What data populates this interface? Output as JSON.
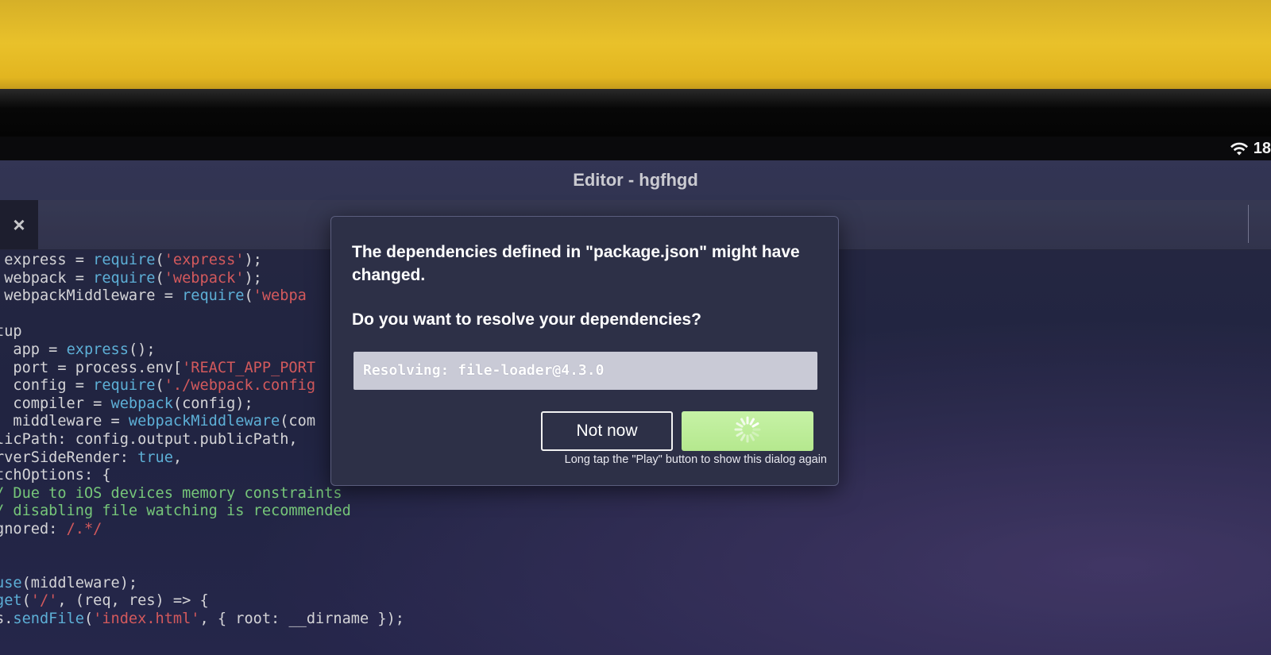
{
  "status": {
    "battery_text": "18",
    "wifi_icon": "wifi-icon"
  },
  "titlebar": {
    "title": "Editor - hgfhgd"
  },
  "tab": {
    "close_symbol": "×"
  },
  "code_lines": [
    [
      [
        "plain",
        " express = "
      ],
      [
        "fn",
        "require"
      ],
      [
        "plain",
        "("
      ],
      [
        "str",
        "'express'"
      ],
      [
        "plain",
        ");"
      ]
    ],
    [
      [
        "plain",
        " webpack = "
      ],
      [
        "fn",
        "require"
      ],
      [
        "plain",
        "("
      ],
      [
        "str",
        "'webpack'"
      ],
      [
        "plain",
        ");"
      ]
    ],
    [
      [
        "plain",
        " webpackMiddleware = "
      ],
      [
        "fn",
        "require"
      ],
      [
        "plain",
        "("
      ],
      [
        "str",
        "'webpa"
      ]
    ],
    [
      [
        "plain",
        ""
      ]
    ],
    [
      [
        "plain",
        "tup"
      ]
    ],
    [
      [
        "plain",
        "  app = "
      ],
      [
        "fn",
        "express"
      ],
      [
        "plain",
        "();"
      ]
    ],
    [
      [
        "plain",
        "  port = process.env["
      ],
      [
        "str",
        "'REACT_APP_PORT"
      ]
    ],
    [
      [
        "plain",
        "  config = "
      ],
      [
        "fn",
        "require"
      ],
      [
        "plain",
        "("
      ],
      [
        "str",
        "'./webpack.config"
      ]
    ],
    [
      [
        "plain",
        "  compiler = "
      ],
      [
        "fn",
        "webpack"
      ],
      [
        "plain",
        "(config);"
      ]
    ],
    [
      [
        "plain",
        "  middleware = "
      ],
      [
        "fn",
        "webpackMiddleware"
      ],
      [
        "plain",
        "(com"
      ]
    ],
    [
      [
        "plain",
        "licPath: config.output.publicPath,"
      ]
    ],
    [
      [
        "plain",
        "rverSideRender: "
      ],
      [
        "fn",
        "true"
      ],
      [
        "plain",
        ","
      ]
    ],
    [
      [
        "plain",
        "tchOptions: {"
      ]
    ],
    [
      [
        "comment",
        "/ Due to iOS devices memory constraints"
      ]
    ],
    [
      [
        "comment",
        "/ disabling file watching is recommended"
      ]
    ],
    [
      [
        "plain",
        "gnored: "
      ],
      [
        "regex",
        "/.*/"
      ]
    ],
    [
      [
        "plain",
        ""
      ]
    ],
    [
      [
        "plain",
        ""
      ]
    ],
    [
      [
        "fn",
        "use"
      ],
      [
        "plain",
        "(middleware);"
      ]
    ],
    [
      [
        "fn",
        "get"
      ],
      [
        "plain",
        "("
      ],
      [
        "str",
        "'/'"
      ],
      [
        "plain",
        ", (req, res) => {"
      ]
    ],
    [
      [
        "plain",
        "s."
      ],
      [
        "fn",
        "sendFile"
      ],
      [
        "plain",
        "("
      ],
      [
        "str",
        "'index.html'"
      ],
      [
        "plain",
        ", { root: __dirname });"
      ]
    ]
  ],
  "dialog": {
    "message": "The dependencies defined in \"package.json\" might have changed.",
    "question": "Do you want to resolve your dependencies?",
    "progress_text": "Resolving: file-loader@4.3.0",
    "not_now_label": "Not now",
    "resolve_button_state": "loading",
    "hint": "Long tap the \"Play\" button to show this dialog again"
  }
}
